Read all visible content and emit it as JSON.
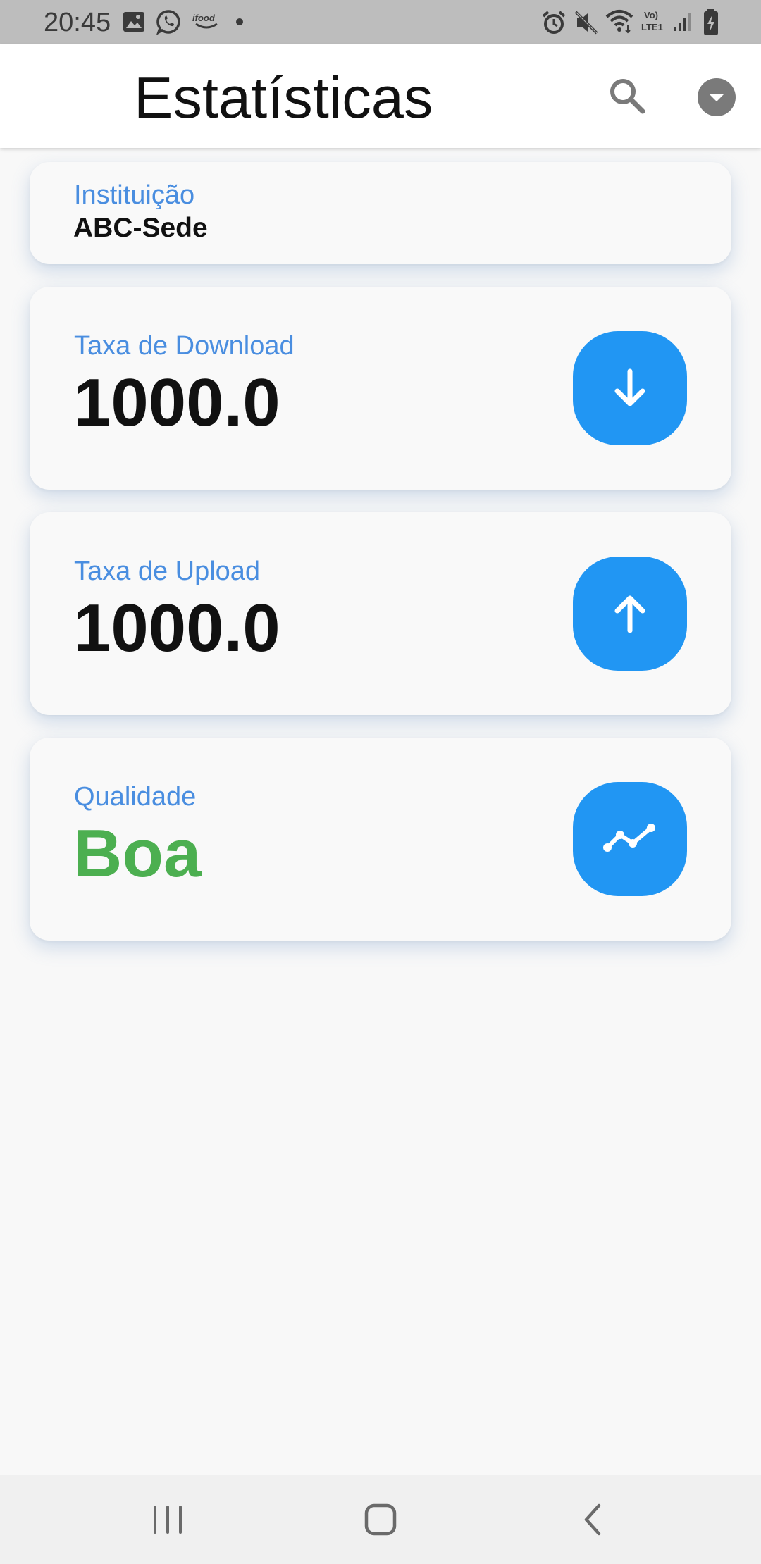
{
  "status_bar": {
    "time": "20:45",
    "icons": [
      "image-icon",
      "whatsapp-icon",
      "ifood-icon",
      "dot-icon",
      "alarm-icon",
      "mute-icon",
      "wifi-icon",
      "volte-icon",
      "signal-icon",
      "battery-icon"
    ],
    "volte_top": "Vo)",
    "volte_bottom": "LTE1",
    "ifood_text": "ifood"
  },
  "app_bar": {
    "title": "Estatísticas",
    "icons": [
      "search-icon",
      "dropdown-menu-icon"
    ]
  },
  "institution_card": {
    "label": "Instituição",
    "value": "ABC-Sede"
  },
  "download_card": {
    "label": "Taxa de Download",
    "value": "1000.0",
    "icon": "arrow-down-icon"
  },
  "upload_card": {
    "label": "Taxa de Upload",
    "value": "1000.0",
    "icon": "arrow-up-icon"
  },
  "quality_card": {
    "label": "Qualidade",
    "value": "Boa",
    "icon": "trending-line-icon"
  },
  "colors": {
    "accent_blue": "#2196f3",
    "label_blue": "#4a8ee0",
    "quality_green": "#4caf50",
    "status_bar": "#bdbdbd"
  },
  "nav_bar": {
    "icons": [
      "recent-apps-icon",
      "home-icon",
      "back-icon"
    ]
  }
}
